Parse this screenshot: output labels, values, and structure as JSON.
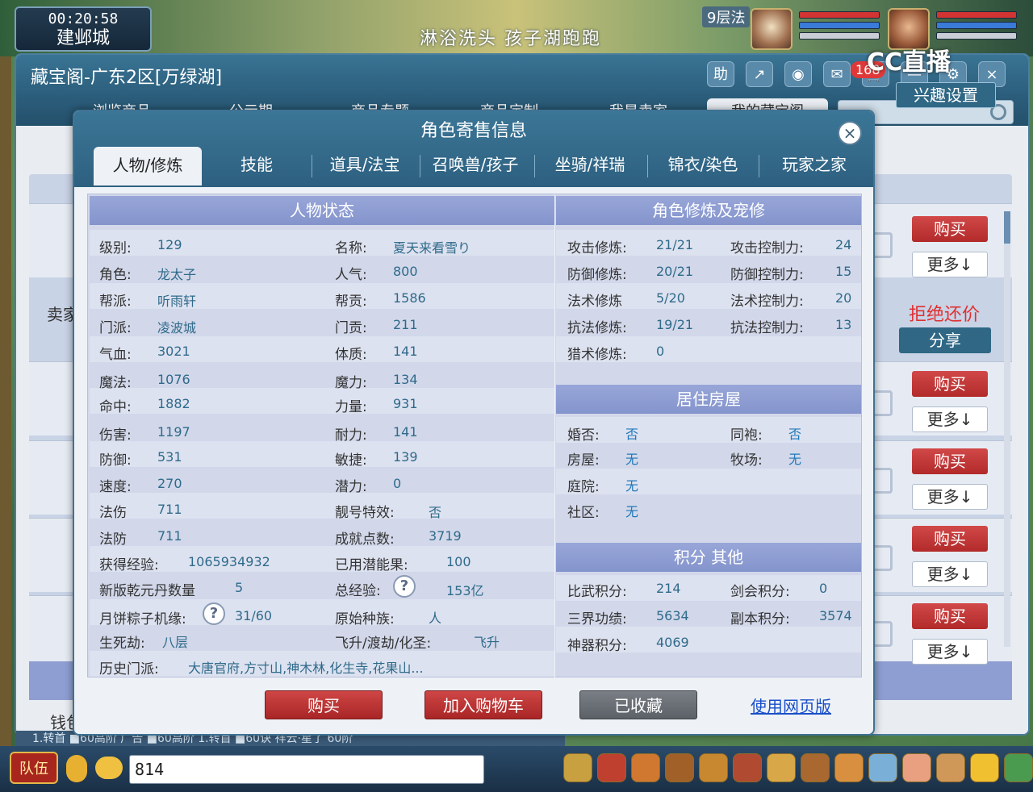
{
  "game": {
    "clock": "00:20:58",
    "city": "建邺城",
    "scroll_text": "淋浴洗头 孩子湖跑跑",
    "floor": "9层法",
    "stream_brand": "CC直播",
    "cart_count": "168",
    "chat_input_value": "814",
    "team_label": "队伍",
    "status_line": "1.转首 ■60高阶 广告 ■60高阶 1.转首 ■60诀 祥云·星了 60阶"
  },
  "store": {
    "title": "藏宝阁-广东2区[万绿湖]",
    "help_icon_label": "助",
    "tabs": [
      "浏览商品",
      "公示期",
      "商品专题",
      "商品定制",
      "我是卖家",
      "我的藏宝阁"
    ],
    "interest_button": "兴趣设置",
    "seller_label": "卖家",
    "money_label": "钱包",
    "refuse_label": "拒绝还价",
    "share_button": "分享",
    "row_buy_label": "购买",
    "row_more_label": "更多↓"
  },
  "modal": {
    "title": "角色寄售信息",
    "close_label": "×",
    "tabs": [
      "人物/修炼",
      "技能",
      "道具/法宝",
      "召唤兽/孩子",
      "坐骑/祥瑞",
      "锦衣/染色",
      "玩家之家"
    ],
    "status_section": "人物状态",
    "cultivation_section": "角色修炼及宠修",
    "house_section": "居住房屋",
    "points_section": "积分 其他",
    "left_rows": [
      {
        "k1": "级别:",
        "v1": "129",
        "k2": "名称:",
        "v2": "夏天来看雪り"
      },
      {
        "k1": "角色:",
        "v1": "龙太子",
        "k2": "人气:",
        "v2": "800"
      },
      {
        "k1": "帮派:",
        "v1": "听雨轩",
        "k2": "帮贡:",
        "v2": "1586"
      },
      {
        "k1": "门派:",
        "v1": "凌波城",
        "k2": "门贡:",
        "v2": "211"
      },
      {
        "k1": "气血:",
        "v1": "3021",
        "k2": "体质:",
        "v2": "141"
      },
      {
        "k1": "魔法:",
        "v1": "1076",
        "k2": "魔力:",
        "v2": "134"
      },
      {
        "k1": "命中:",
        "v1": "1882",
        "k2": "力量:",
        "v2": "931"
      },
      {
        "k1": "伤害:",
        "v1": "1197",
        "k2": "耐力:",
        "v2": "141"
      },
      {
        "k1": "防御:",
        "v1": "531",
        "k2": "敏捷:",
        "v2": "139"
      },
      {
        "k1": "速度:",
        "v1": "270",
        "k2": "潜力:",
        "v2": "0"
      },
      {
        "k1": "法伤",
        "v1": "711",
        "k2": "靓号特效:",
        "v2": "否"
      },
      {
        "k1": "法防",
        "v1": "711",
        "k2": "成就点数:",
        "v2": "3719"
      }
    ],
    "exp_label": "获得经验:",
    "exp_value": "1065934932",
    "used_fruit_label": "已用潜能果:",
    "used_fruit_value": "100",
    "qianyuan_label": "新版乾元丹数量",
    "qianyuan_value": "5",
    "total_exp_label": "总经验:",
    "total_exp_value": "153亿",
    "mooncake_label": "月饼粽子机缘:",
    "mooncake_value": "31/60",
    "race_label": "原始种族:",
    "race_value": "人",
    "shengsi_label": "生死劫:",
    "shengsi_value": "八层",
    "feisheng_label": "飞升/渡劫/化圣:",
    "feisheng_value": "飞升",
    "history_label": "历史门派:",
    "history_value": "大唐官府,方寸山,神木林,化生寺,花果山...",
    "cultivation_rows": [
      {
        "k1": "攻击修炼:",
        "v1": "21/21",
        "k2": "攻击控制力:",
        "v2": "24"
      },
      {
        "k1": "防御修炼:",
        "v1": "20/21",
        "k2": "防御控制力:",
        "v2": "15"
      },
      {
        "k1": "法术修炼",
        "v1": "5/20",
        "k2": "法术控制力:",
        "v2": "20"
      },
      {
        "k1": "抗法修炼:",
        "v1": "19/21",
        "k2": "抗法控制力:",
        "v2": "13"
      },
      {
        "k1": "猎术修炼:",
        "v1": "0",
        "k2": "",
        "v2": ""
      }
    ],
    "house_rows": [
      {
        "k1": "婚否:",
        "v1": "否",
        "k2": "同袍:",
        "v2": "否"
      },
      {
        "k1": "房屋:",
        "v1": "无",
        "k2": "牧场:",
        "v2": "无"
      },
      {
        "k1": "庭院:",
        "v1": "无",
        "k2": "",
        "v2": ""
      },
      {
        "k1": "社区:",
        "v1": "无",
        "k2": "",
        "v2": ""
      }
    ],
    "points_rows": [
      {
        "k1": "比武积分:",
        "v1": "214",
        "k2": "剑会积分:",
        "v2": "0"
      },
      {
        "k1": "三界功绩:",
        "v1": "5634",
        "k2": "副本积分:",
        "v2": "3574"
      },
      {
        "k1": "神器积分:",
        "v1": "4069",
        "k2": "",
        "v2": ""
      }
    ],
    "buy_button": "购买",
    "add_cart_button": "加入购物车",
    "collected_button": "已收藏",
    "web_link": "使用网页版",
    "help_mark": "?"
  },
  "colors": {
    "accent": "#2f6785",
    "buy_red": "#b22a2a",
    "value_text": "#2f6a8a",
    "section_head": "#8d9cd2"
  }
}
